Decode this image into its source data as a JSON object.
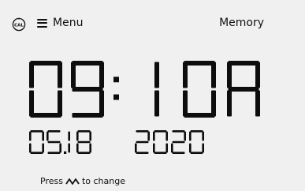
{
  "header": {
    "cal_icon": "cal-badge-icon",
    "cal_badge_text": "CAL",
    "menu_icon": "hamburger-icon",
    "menu_label": "Menu",
    "memory_label": "Memory"
  },
  "time": {
    "display": "09:10A",
    "hour": "09",
    "minute": "10",
    "meridiem": "A"
  },
  "date": {
    "display": "05.18 2020",
    "month": "05",
    "day": "18",
    "year": "2020"
  },
  "hint": {
    "before": "Press",
    "icon": "up-down-arrows-icon",
    "after": "to change"
  }
}
